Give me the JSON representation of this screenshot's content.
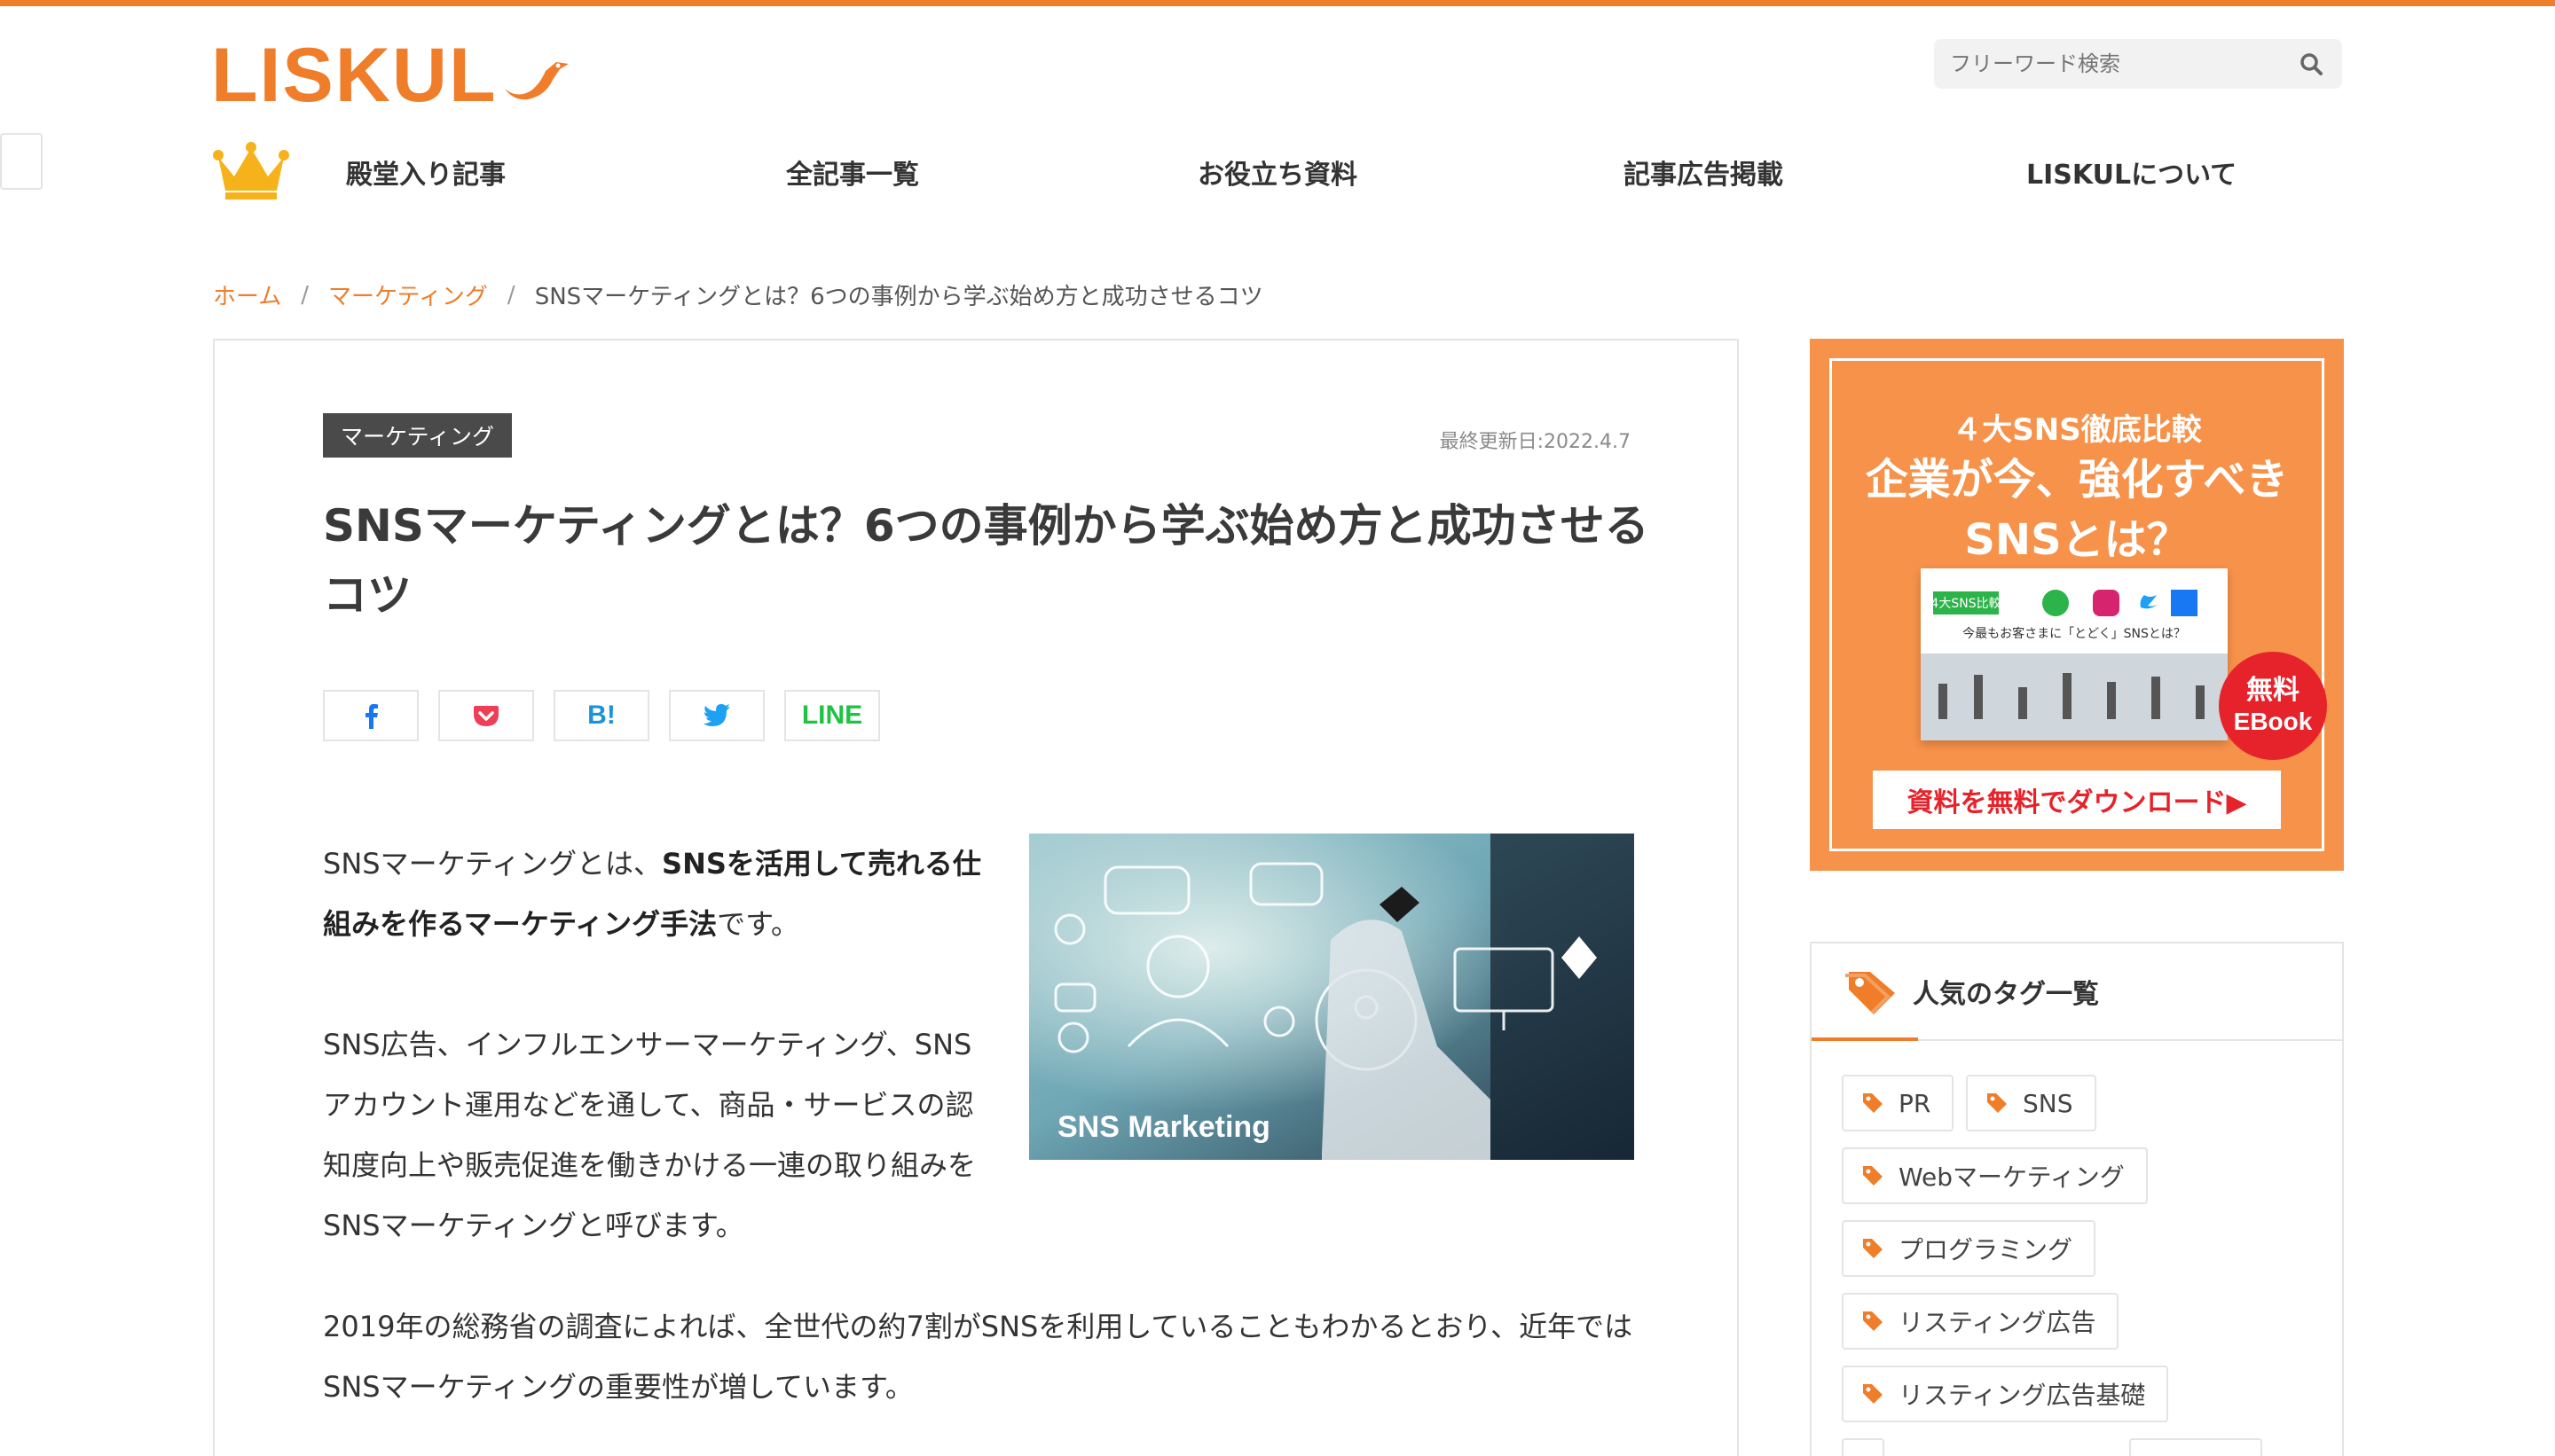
{
  "brand": {
    "logo_text": "LISKUL",
    "accent_color": "#ef7d2a"
  },
  "search": {
    "placeholder": "フリーワード検索"
  },
  "nav": {
    "items": [
      {
        "label": "殿堂入り記事"
      },
      {
        "label": "全記事一覧"
      },
      {
        "label": "お役立ち資料"
      },
      {
        "label": "記事広告掲載"
      },
      {
        "label": "LISKULについて"
      }
    ]
  },
  "breadcrumb": {
    "home": "ホーム",
    "category": "マーケティング",
    "current": "SNSマーケティングとは？6つの事例から学ぶ始め方と成功させるコツ",
    "separator": "/"
  },
  "article": {
    "category": "マーケティング",
    "updated": "最終更新日:2022.4.7",
    "title": "SNSマーケティングとは？6つの事例から学ぶ始め方と成功させるコツ",
    "share": {
      "facebook_icon": "facebook-icon",
      "pocket_icon": "pocket-icon",
      "hatena_label": "B!",
      "twitter_icon": "twitter-icon",
      "line_label": "LINE"
    },
    "para1_pre": "SNSマーケティングとは、",
    "para1_bold": "SNSを活用して売れる仕組みを作るマーケティング手法",
    "para1_post": "です。",
    "para2": "SNS広告、インフルエンサーマーケティング、SNSアカウント運用などを通して、商品・サービスの認知度向上や販売促進を働きかける一連の取り組みをSNSマーケティングと呼びます。",
    "para3": "2019年の総務省の調査によれば、全世代の約7割がSNSを利用していることもわかるとおり、近年ではSNSマーケティングの重要性が増しています。",
    "hero_caption": "SNS Marketing"
  },
  "ad": {
    "subtitle": "４大SNS徹底比較",
    "title_line1": "企業が今、強化すべき",
    "title_line2": "SNSとは？",
    "book_tag": "4大SNS比較",
    "book_line": "今最もお客さまに「とどく」SNSとは？",
    "badge_line1": "無料",
    "badge_line2": "EBook",
    "cta": "資料を無料でダウンロード▶",
    "bg_color": "#f7924a"
  },
  "tags_panel": {
    "title": "人気のタグ一覧",
    "tags": [
      {
        "label": "PR"
      },
      {
        "label": "SNS"
      },
      {
        "label": "Webマーケティング"
      },
      {
        "label": "プログラミング"
      },
      {
        "label": "リスティング広告"
      },
      {
        "label": "リスティング広告基礎"
      }
    ]
  }
}
